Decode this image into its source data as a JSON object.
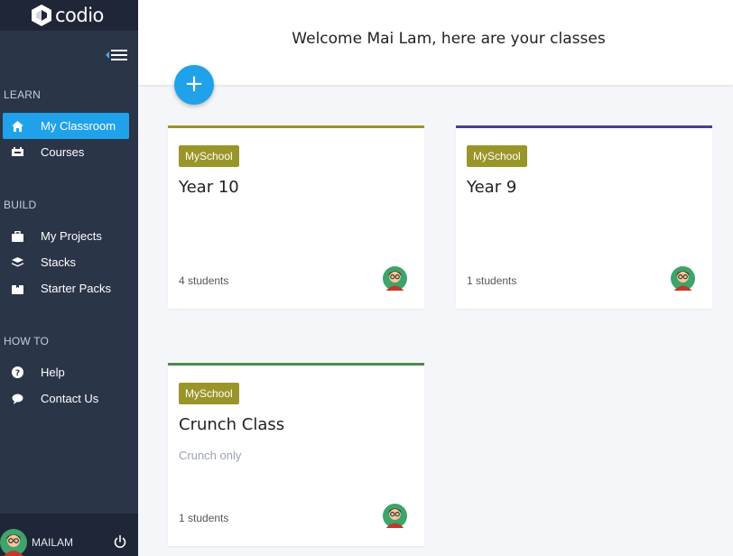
{
  "app": {
    "brand": "codio"
  },
  "sidebar": {
    "sections": [
      {
        "title": "LEARN",
        "items": [
          {
            "label": "My Classroom",
            "icon": "home-icon",
            "active": true
          },
          {
            "label": "Courses",
            "icon": "courses-icon",
            "active": false
          }
        ]
      },
      {
        "title": "BUILD",
        "items": [
          {
            "label": "My Projects",
            "icon": "briefcase-icon",
            "active": false
          },
          {
            "label": "Stacks",
            "icon": "stacks-icon",
            "active": false
          },
          {
            "label": "Starter Packs",
            "icon": "starter-pack-icon",
            "active": false
          }
        ]
      },
      {
        "title": "HOW TO",
        "items": [
          {
            "label": "Help",
            "icon": "help-icon",
            "active": false
          },
          {
            "label": "Contact Us",
            "icon": "chat-icon",
            "active": false
          }
        ]
      }
    ],
    "user": {
      "name": "MAILAM"
    }
  },
  "header": {
    "title": "Welcome Mai Lam, here are your classes",
    "add_label": "+"
  },
  "classes": [
    {
      "badge": "MySchool",
      "name": "Year 10",
      "description": "",
      "students": "4 students",
      "accent": "#9a9528"
    },
    {
      "badge": "MySchool",
      "name": "Year 9",
      "description": "",
      "students": "1 students",
      "accent": "#4a3f8c"
    },
    {
      "badge": "MySchool",
      "name": "Crunch Class",
      "description": "Crunch only",
      "students": "1 students",
      "accent": "#4f8a4f"
    }
  ],
  "colors": {
    "sidebar_bg": "#2b3548",
    "accent_blue": "#1fa2ea",
    "badge": "#9a9528"
  }
}
